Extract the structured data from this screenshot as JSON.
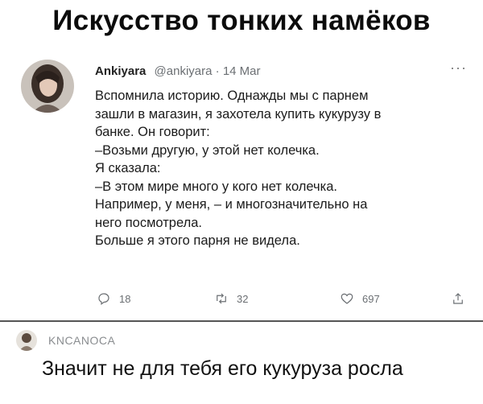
{
  "meme_title": "Искусство тонких намёков",
  "tweet": {
    "author_name": "Ankiyara",
    "author_handle": "@ankiyara",
    "separator": "·",
    "date": "14 Mar",
    "more_icon": "more-horizontal-icon",
    "lines": [
      "Вспомнила историю. Однажды мы с парнем",
      "зашли в магазин, я захотела купить кукурузу в",
      "банке. Он говорит:",
      "–Возьми другую, у этой нет колечка.",
      "Я сказала:",
      "–В этом мире много у кого нет колечка.",
      "Например, у меня, – и многозначительно на",
      "него посмотрела.",
      "Больше я этого парня не видела."
    ],
    "actions": {
      "reply_count": "18",
      "retweet_count": "32",
      "like_count": "697"
    }
  },
  "comment": {
    "author": "KNCANOCA",
    "text": "Значит не для тебя его кукуруза росла"
  }
}
